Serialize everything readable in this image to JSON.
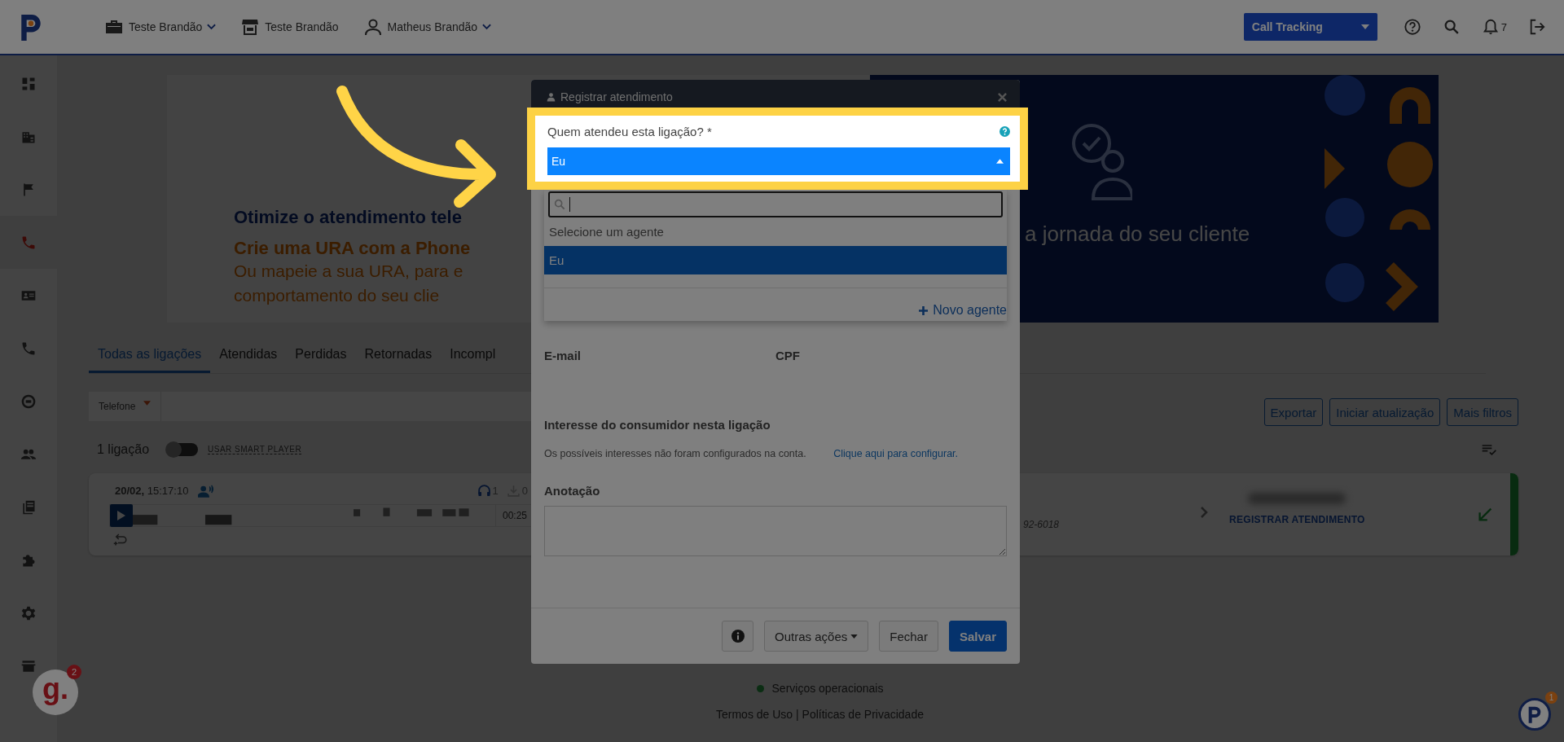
{
  "topbar": {
    "nav": [
      {
        "label": "Teste Brandão",
        "dropdown": true
      },
      {
        "label": "Teste Brandão",
        "dropdown": false
      },
      {
        "label": "Matheus Brandão",
        "dropdown": true
      }
    ],
    "product": "Call Tracking",
    "notifications": "7"
  },
  "sidebar": {
    "items": [
      {
        "selected": false
      },
      {
        "selected": false
      },
      {
        "selected": false
      },
      {
        "selected": true
      },
      {
        "selected": false
      },
      {
        "selected": false
      },
      {
        "selected": false
      },
      {
        "selected": false
      },
      {
        "selected": false
      },
      {
        "selected": false
      },
      {
        "selected": false
      },
      {
        "selected": false
      }
    ]
  },
  "banner": {
    "title": "Otimize o atendimento tele",
    "subtitle": "Crie uma URA com a Phone",
    "lines": [
      "Ou mapeie a sua URA, para e",
      "comportamento do seu clie"
    ],
    "right_text": "a jornada do seu cliente"
  },
  "tabs": [
    {
      "label": "Todas as ligações",
      "selected": true
    },
    {
      "label": "Atendidas",
      "selected": false
    },
    {
      "label": "Perdidas",
      "selected": false
    },
    {
      "label": "Retornadas",
      "selected": false
    },
    {
      "label": "Incompl",
      "selected": false
    }
  ],
  "filter": {
    "field": "Telefone"
  },
  "buttons": [
    "Exportar",
    "Iniciar atualização",
    "Mais filtros"
  ],
  "count": "1 ligação",
  "smart_player": {
    "label": "USAR SMART PLAYER",
    "on": false
  },
  "calls": [
    {
      "datetime": "**20/02,** 15:17:10",
      "listens": "1",
      "downloads": "0",
      "duration": "00:25",
      "phone": "92-6018",
      "action": "REGISTRAR ATENDIMENTO"
    }
  ],
  "modal": {
    "title": "Registrar atendimento",
    "agent_label": "Quem atendeu esta ligação? *",
    "agent_value": "Eu",
    "options": [
      {
        "label": "Selecione um agente",
        "selected": false
      },
      {
        "label": "Eu",
        "selected": true
      }
    ],
    "new_agent": "Novo agente",
    "fields": [
      "E-mail",
      "CPF"
    ],
    "interest_title": "Interesse do consumidor nesta ligação",
    "interest_text": "Os possíveis interesses não foram configurados na conta.",
    "interest_link": "Clique aqui para configurar.",
    "note_label": "Anotação",
    "other_actions": "Outras ações",
    "close": "Fechar",
    "save": "Salvar"
  },
  "footer": {
    "status": "Serviços operacionais",
    "links": "Termos de Uso | Políticas de Privacidade"
  },
  "widgets": [
    {
      "logo": "g.",
      "count": "2"
    },
    {
      "count": "1"
    }
  ]
}
